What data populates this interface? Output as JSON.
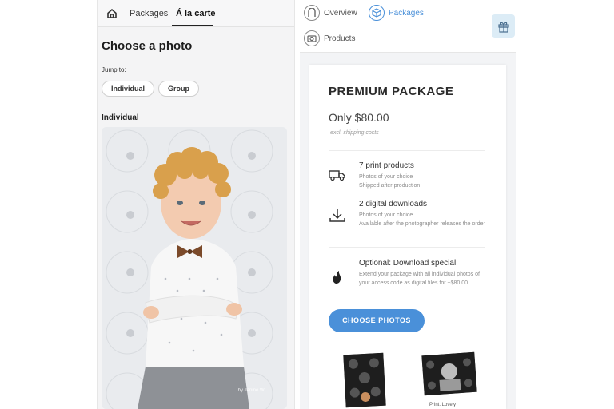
{
  "left": {
    "tabs": [
      "Packages",
      "Á la carte"
    ],
    "title": "Choose a photo",
    "jump_label": "Jump to:",
    "jump_buttons": [
      "Individual",
      "Group"
    ],
    "section_label": "Individual",
    "photo_credit": "by Janine Wi..."
  },
  "right": {
    "nav": {
      "overview": "Overview",
      "packages": "Packages",
      "products": "Products"
    },
    "package": {
      "title": "PREMIUM PACKAGE",
      "price": "Only $80.00",
      "excl": "excl. shipping costs",
      "features": [
        {
          "icon": "truck-icon",
          "title": "7 print products",
          "lines": "Photos of your choice\nShipped after production"
        },
        {
          "icon": "download-icon",
          "title": "2 digital downloads",
          "lines": "Photos of your choice\nAvailable after the photographer releases the order"
        },
        {
          "icon": "fire-icon",
          "title": "Optional: Download special",
          "lines": "Extend your package with all individual photos of your access code as digital files for +$80.00."
        }
      ],
      "cta": "CHOOSE PHOTOS"
    },
    "thumb_label": "Print. Lovely"
  },
  "colors": {
    "accent": "#4a90d9",
    "gift_bg": "#dcecf6"
  }
}
